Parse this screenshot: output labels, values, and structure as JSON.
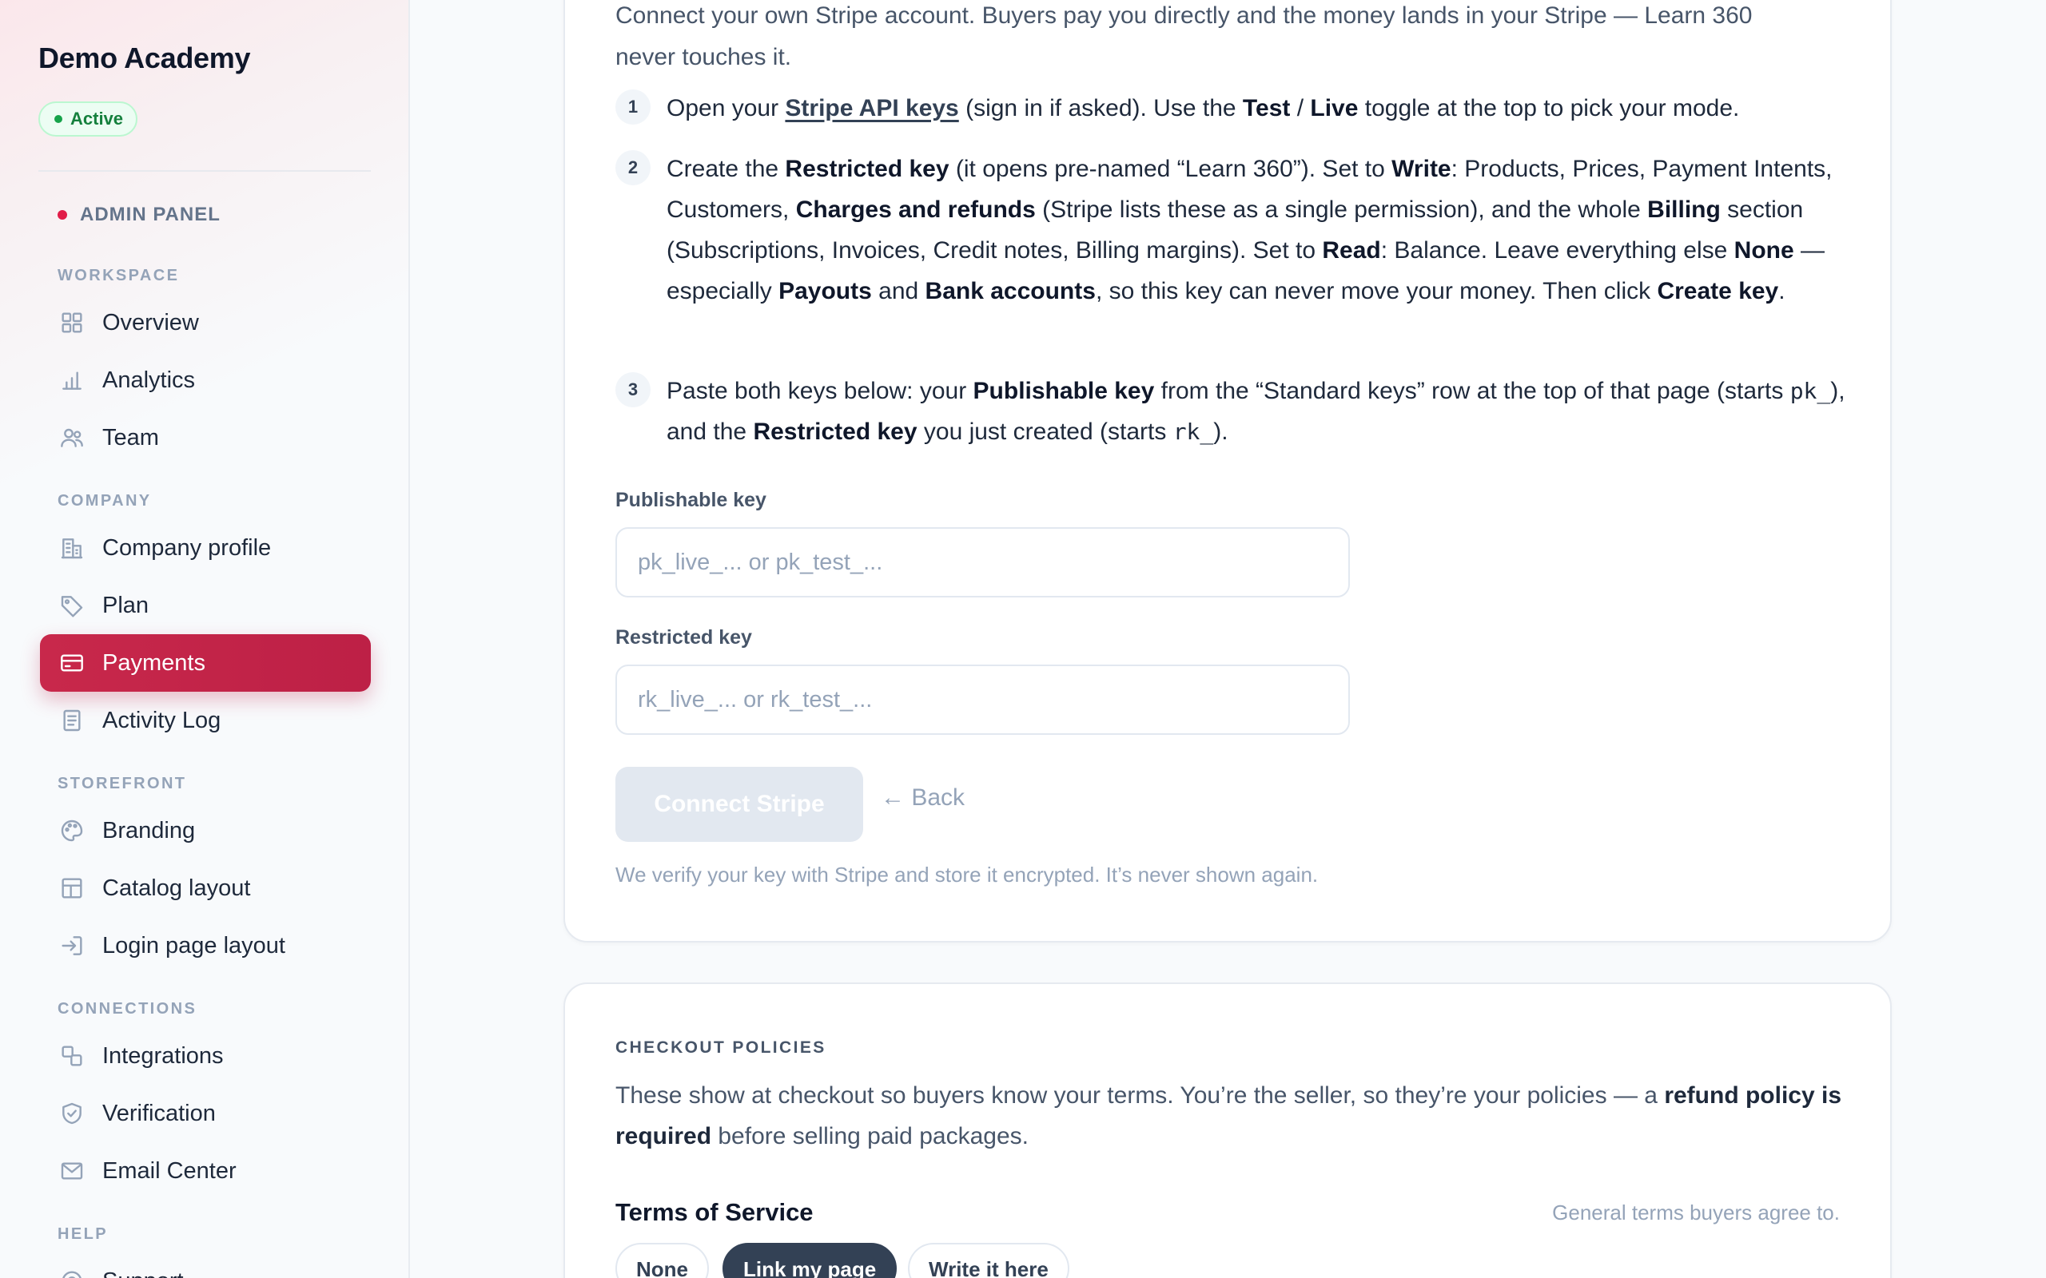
{
  "sidebar": {
    "brand": "Demo Academy",
    "status": "Active",
    "admin_label": "ADMIN PANEL",
    "sections": {
      "workspace": "WORKSPACE",
      "company": "COMPANY",
      "storefront": "STOREFRONT",
      "connections": "CONNECTIONS",
      "help": "HELP"
    },
    "items": [
      {
        "label": "Overview",
        "icon": "grid-icon"
      },
      {
        "label": "Analytics",
        "icon": "bar-chart-icon"
      },
      {
        "label": "Team",
        "icon": "users-icon"
      },
      {
        "label": "Company profile",
        "icon": "building-icon"
      },
      {
        "label": "Plan",
        "icon": "tag-icon"
      },
      {
        "label": "Payments",
        "icon": "credit-card-icon",
        "active": true
      },
      {
        "label": "Activity Log",
        "icon": "document-icon"
      },
      {
        "label": "Branding",
        "icon": "palette-icon"
      },
      {
        "label": "Catalog layout",
        "icon": "layout-icon"
      },
      {
        "label": "Login page layout",
        "icon": "login-icon"
      },
      {
        "label": "Integrations",
        "icon": "integrations-icon"
      },
      {
        "label": "Verification",
        "icon": "shield-check-icon"
      },
      {
        "label": "Email Center",
        "icon": "mail-icon"
      },
      {
        "label": "Support",
        "icon": "support-icon"
      }
    ]
  },
  "stripe": {
    "intro_line1": "Connect your own Stripe account. Buyers pay you directly and the money lands in your Stripe — Learn 360",
    "intro_line2": "never touches it.",
    "steps": [
      {
        "number": "1"
      },
      {
        "number": "2"
      },
      {
        "number": "3"
      }
    ],
    "step1": {
      "t1": "Open your ",
      "link": "Stripe API keys",
      "t2": " (sign in if asked). Use the ",
      "b1": "Test",
      "t3": " / ",
      "b2": "Live",
      "t4": " toggle at the top to pick your mode."
    },
    "step2": {
      "t1": "Create the ",
      "b1": "Restricted key",
      "t2": " (it opens pre-named “Learn 360”). Set to ",
      "b2": "Write",
      "t3": ": Products, Prices, Payment Intents, Customers, ",
      "b3": "Charges and refunds",
      "t4": " (Stripe lists these as a single permission), and the whole ",
      "b4": "Billing",
      "t5": " section (Subscriptions, Invoices, Credit notes, Billing margins). Set to ",
      "b5": "Read",
      "t6": ": Balance. Leave everything else ",
      "b6": "None",
      "t7": " — especially ",
      "b7": "Payouts",
      "t8": " and ",
      "b8": "Bank accounts",
      "t9": ", so this key can never move your money. Then click ",
      "b9": "Create key",
      "t10": "."
    },
    "step3": {
      "t1": "Paste both keys below: your ",
      "b1": "Publishable key",
      "t2": " from the “Standard keys” row at the top of that page (starts ",
      "c1": "pk_",
      "t3": "), and the ",
      "b2": "Restricted key",
      "t4": " you just created (starts ",
      "c2": "rk_",
      "t5": ")."
    },
    "publishable": {
      "label": "Publishable key",
      "placeholder": "pk_live_... or pk_test_...",
      "value": ""
    },
    "restricted": {
      "label": "Restricted key",
      "placeholder": "rk_live_... or rk_test_...",
      "value": ""
    },
    "connect_label": "Connect Stripe",
    "back_label": "← Back",
    "note": "We verify your key with Stripe and store it encrypted. It’s never shown again."
  },
  "policies": {
    "heading": "CHECKOUT POLICIES",
    "desc_t1": "These show at checkout so buyers know your terms. You’re the seller, so they’re your policies — a ",
    "desc_b1": "refund policy is required",
    "desc_t2": " before selling paid packages.",
    "tos": {
      "title": "Terms of Service",
      "hint": "General terms buyers agree to.",
      "options": [
        "None",
        "Link my page",
        "Write it here"
      ],
      "selected": "Link my page"
    }
  },
  "colors": {
    "accent": "#c8284b",
    "active_status": "#15803d",
    "selected_segment": "#334155",
    "disabled_button": "#e2e8f0"
  }
}
